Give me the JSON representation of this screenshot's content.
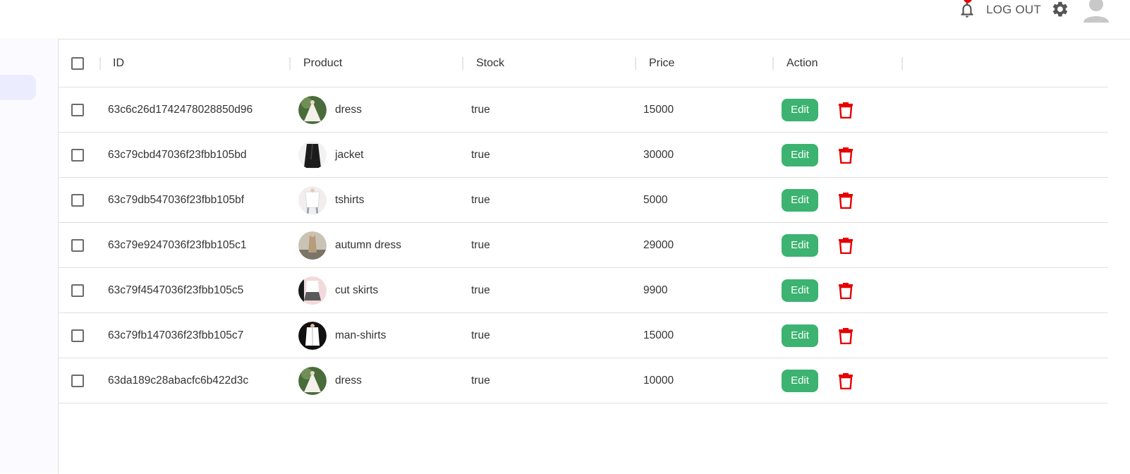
{
  "header": {
    "notifications_badge": "4",
    "logout_label": "LOG OUT"
  },
  "table": {
    "columns": [
      "ID",
      "Product",
      "Stock",
      "Price",
      "Action"
    ],
    "edit_label": "Edit",
    "rows": [
      {
        "id": "63c6c26d1742478028850d96",
        "product": "dress",
        "stock": "true",
        "price": "15000"
      },
      {
        "id": "63c79cbd47036f23fbb105bd",
        "product": "jacket",
        "stock": "true",
        "price": "30000"
      },
      {
        "id": "63c79db547036f23fbb105bf",
        "product": "tshirts",
        "stock": "true",
        "price": "5000"
      },
      {
        "id": "63c79e9247036f23fbb105c1",
        "product": "autumn dress",
        "stock": "true",
        "price": "29000"
      },
      {
        "id": "63c79f4547036f23fbb105c5",
        "product": "cut skirts",
        "stock": "true",
        "price": "9900"
      },
      {
        "id": "63c79fb147036f23fbb105c7",
        "product": "man-shirts",
        "stock": "true",
        "price": "15000"
      },
      {
        "id": "63da189c28abacfc6b422d3c",
        "product": "dress",
        "stock": "true",
        "price": "10000"
      }
    ]
  }
}
